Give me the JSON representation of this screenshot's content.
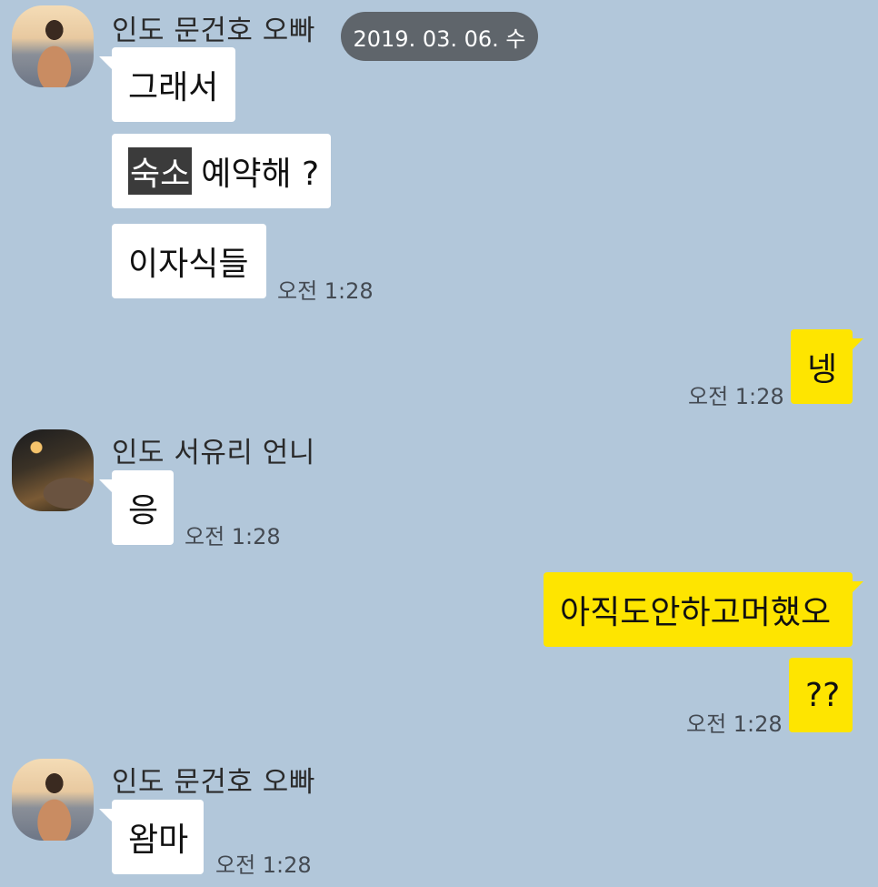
{
  "date_divider": "2019. 03. 06. 수",
  "groups": [
    {
      "sender": "인도 문건호 오빠",
      "messages": [
        "그래서",
        "숙소",
        "예약해 ?",
        "이자식들"
      ],
      "time": "오전 1:28"
    },
    {
      "sender": "me",
      "messages": [
        "넹"
      ],
      "time": "오전 1:28"
    },
    {
      "sender": "인도 서유리 언니",
      "messages": [
        "응"
      ],
      "time": "오전 1:28"
    },
    {
      "sender": "me",
      "messages": [
        "아직도안하고머했오",
        "??"
      ],
      "time": "오전 1:28"
    },
    {
      "sender": "인도 문건호 오빠",
      "messages": [
        "왐마"
      ],
      "time": "오전 1:28"
    }
  ],
  "colors": {
    "background": "#b2c7da",
    "incoming_bubble": "#ffffff",
    "outgoing_bubble": "#fee500",
    "date_pill": "#5f656b",
    "highlight": "#3b3b3b"
  },
  "icons": {
    "avatar_1": "profile-photo-man",
    "avatar_2": "profile-photo-night-street"
  }
}
